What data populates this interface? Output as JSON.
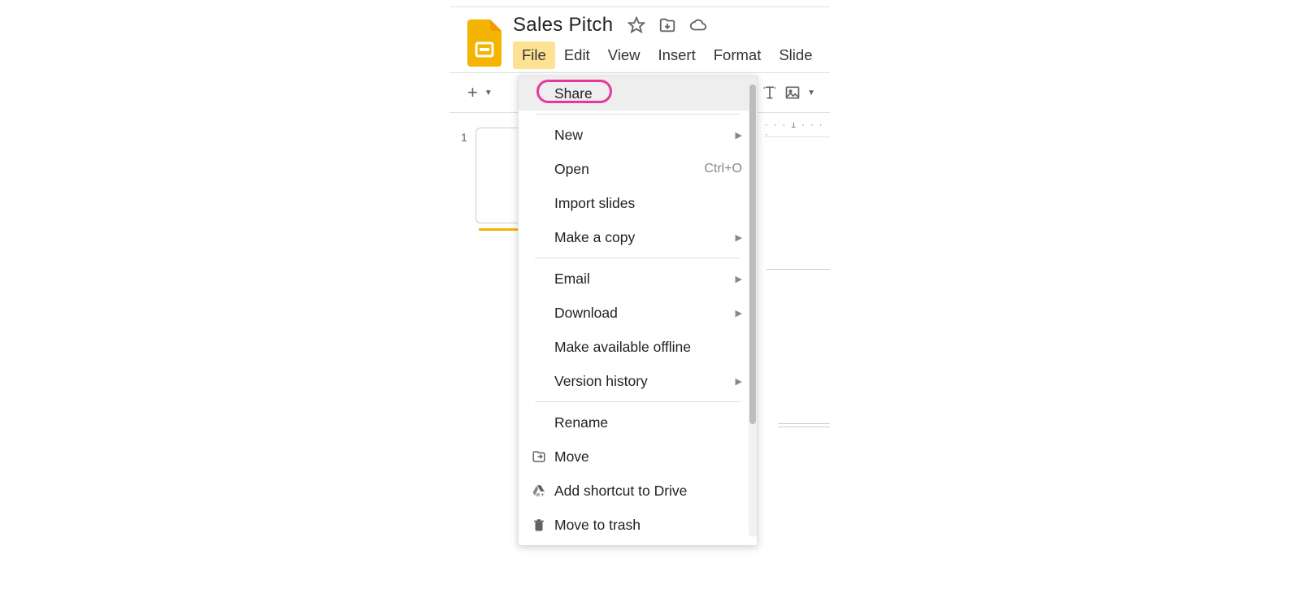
{
  "document": {
    "title": "Sales Pitch"
  },
  "menubar": {
    "file": "File",
    "edit": "Edit",
    "view": "View",
    "insert": "Insert",
    "format": "Format",
    "slide": "Slide"
  },
  "thumbnail": {
    "number": "1"
  },
  "ruler": {
    "fragment_text": "· · ·  1  · · · ·"
  },
  "file_menu": {
    "share": "Share",
    "new": "New",
    "open": "Open",
    "open_shortcut": "Ctrl+O",
    "import_slides": "Import slides",
    "make_a_copy": "Make a copy",
    "email": "Email",
    "download": "Download",
    "make_available_offline": "Make available offline",
    "version_history": "Version history",
    "rename": "Rename",
    "move": "Move",
    "add_shortcut_to_drive": "Add shortcut to Drive",
    "move_to_trash": "Move to trash"
  }
}
